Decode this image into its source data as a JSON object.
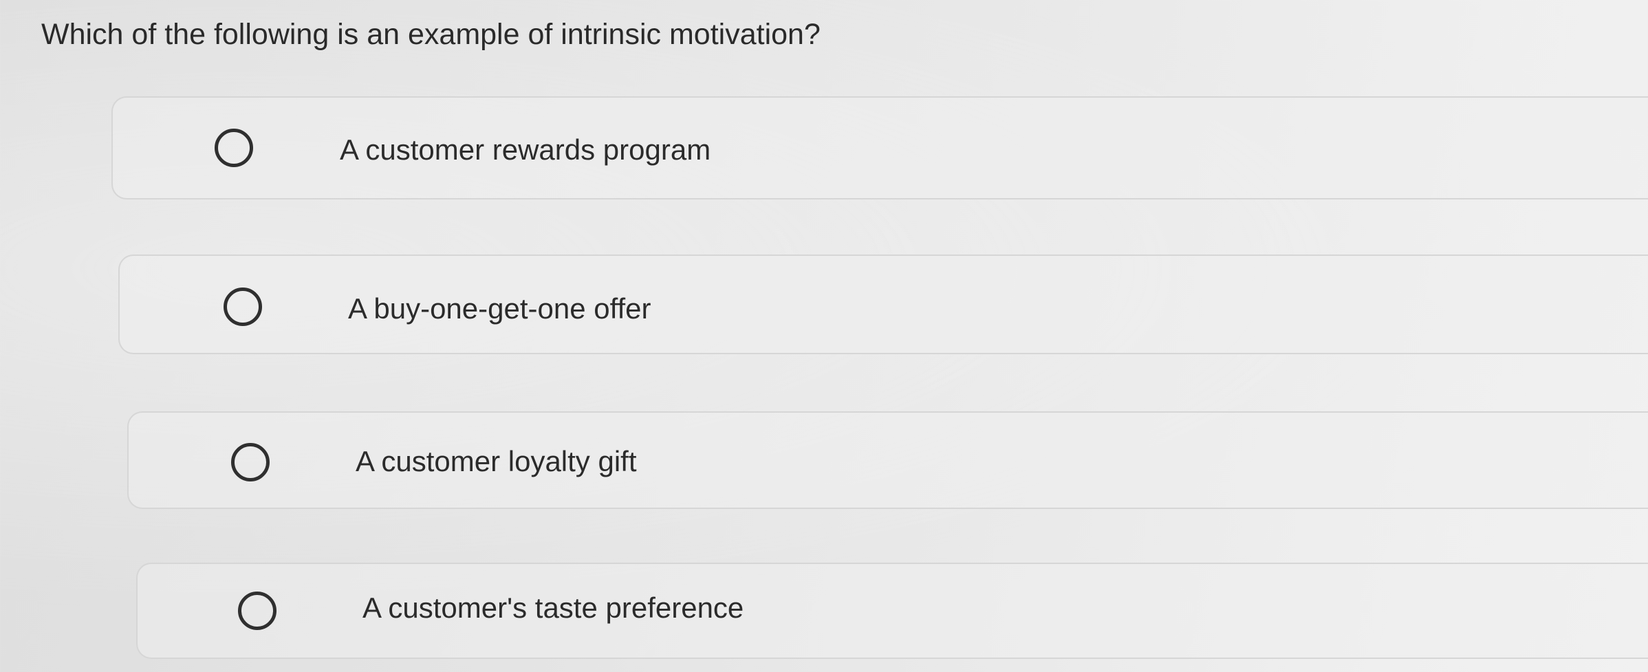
{
  "question": {
    "text": "Which of the following is an example of intrinsic motivation?"
  },
  "choices": [
    {
      "label": "A customer rewards program"
    },
    {
      "label": "A buy-one-get-one offer"
    },
    {
      "label": "A customer loyalty gift"
    },
    {
      "label": "A customer's taste preference"
    }
  ]
}
